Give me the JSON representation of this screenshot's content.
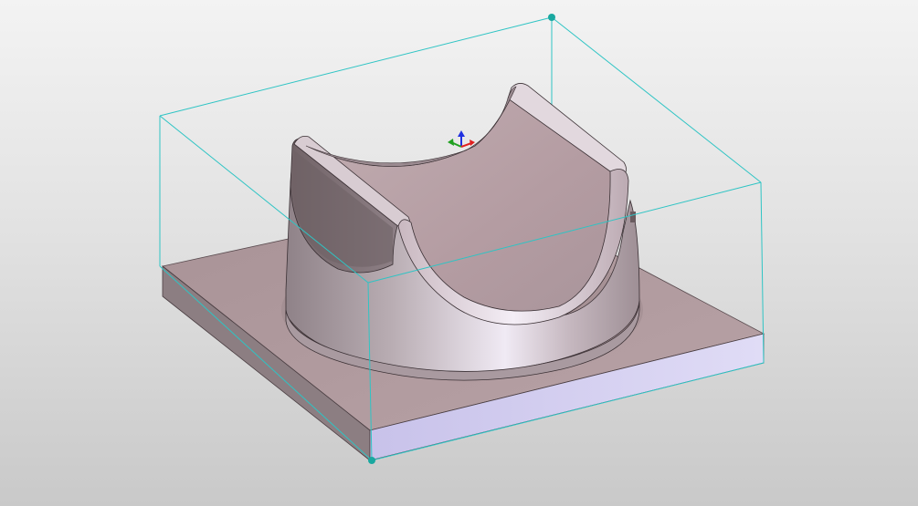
{
  "viewport": {
    "background_top": "#f3f3f3",
    "background_bottom": "#c9c9c9"
  },
  "model": {
    "base_plate": {
      "top_color": "#b09a9e",
      "front_color": "#d8d4f0",
      "left_color": "#8c7e82"
    },
    "cradle": {
      "body_color": "#b8a8ae",
      "highlight_color": "#ece6f2",
      "shadow_color": "#7e6e74"
    }
  },
  "bounding_box": {
    "color": "#2ec4c4",
    "handle_color": "#1aa8a0"
  },
  "triad": {
    "axes": [
      "x-axis",
      "y-axis",
      "z-axis"
    ],
    "colors": {
      "x": "#e02020",
      "y": "#20a020",
      "z": "#2030e0"
    }
  }
}
